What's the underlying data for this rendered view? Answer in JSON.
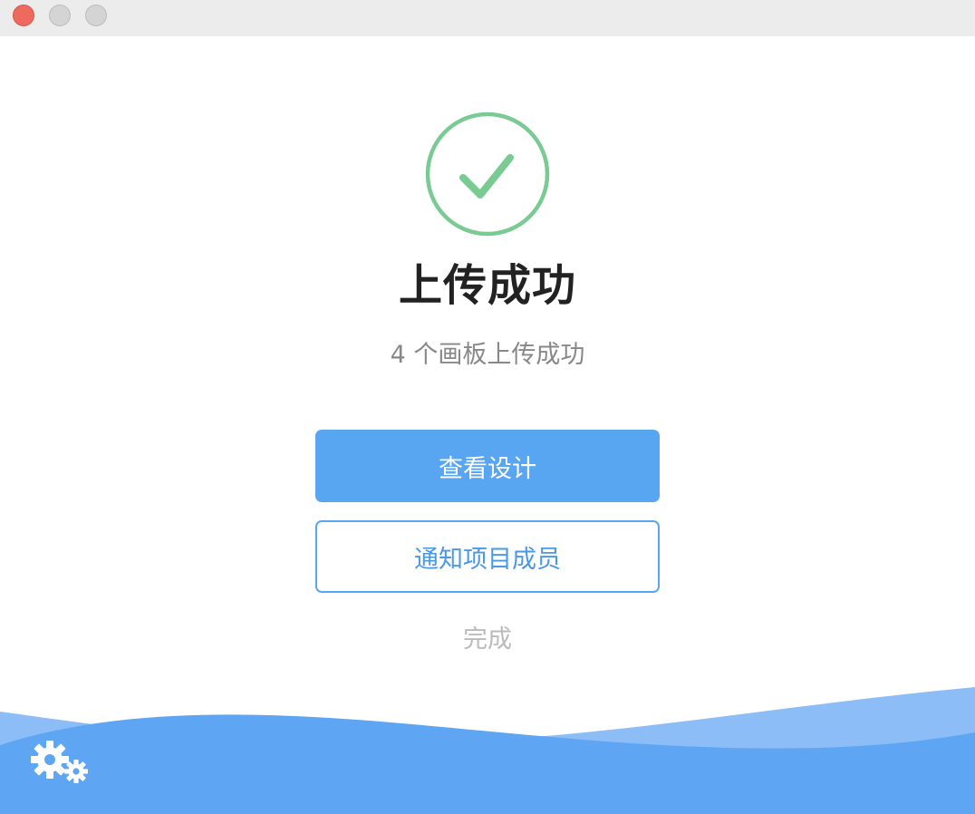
{
  "window": {
    "controls": {
      "close": "close-button",
      "minimize": "minimize-button",
      "maximize": "maximize-button"
    }
  },
  "status": {
    "icon": "checkmark-circle-icon",
    "title": "上传成功",
    "subtitle": "4 个画板上传成功"
  },
  "actions": {
    "view_design": "查看设计",
    "notify_members": "通知项目成员",
    "done": "完成"
  },
  "footer": {
    "settings_icon": "gear-icon"
  },
  "colors": {
    "success_green": "#7acb93",
    "accent_blue": "#58a6f2",
    "wave_light": "#8cbdf6",
    "wave_dark": "#5ea5f4",
    "title_text": "#222222",
    "muted_text": "#888888",
    "disabled_text": "#bbbbbb"
  }
}
